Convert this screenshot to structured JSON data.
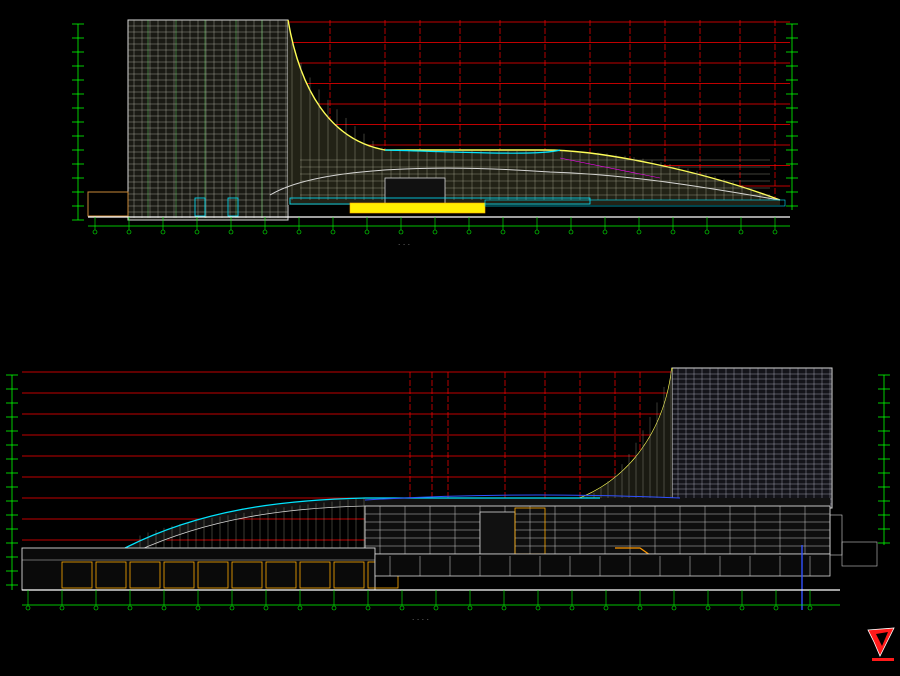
{
  "drawing": {
    "background": "#000000",
    "colors": {
      "grid_red": "#ff0000",
      "grid_green": "#00ff00",
      "facade_gray": "#c8c8c8",
      "facade_yellow": "#ffff00",
      "cyan": "#00e5ff",
      "magenta": "#ff00ff",
      "white": "#ffffff",
      "blue": "#3050ff",
      "brown": "#c88838",
      "orange": "#ff9900"
    },
    "elevations": [
      {
        "id": "upper-elevation",
        "caption": "- - -"
      },
      {
        "id": "lower-elevation",
        "caption": "- - - -"
      }
    ],
    "logo": {
      "name": "red-stamp-logo"
    }
  }
}
